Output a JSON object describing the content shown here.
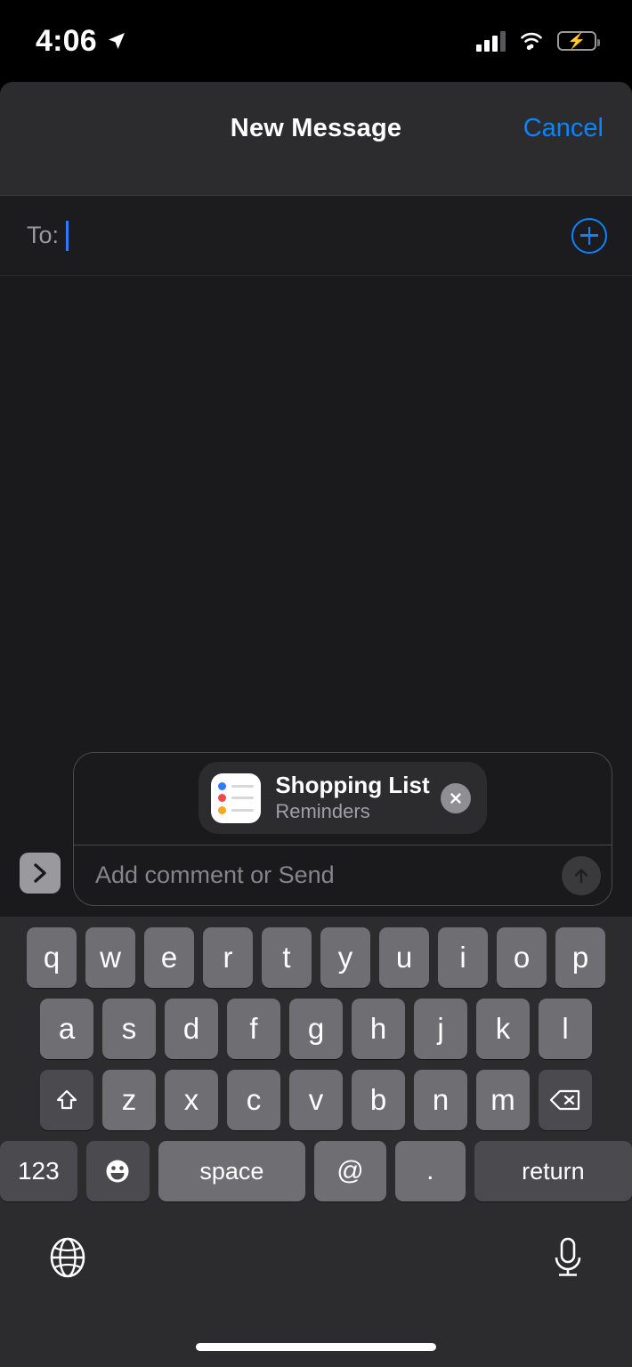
{
  "status_bar": {
    "time": "4:06",
    "location_icon": "location-arrow-icon",
    "signal_icon": "cellular-signal-icon",
    "wifi_icon": "wifi-icon",
    "battery_icon": "battery-charging-icon",
    "battery_color": "#4CD964"
  },
  "nav": {
    "title": "New Message",
    "cancel_label": "Cancel",
    "accent_color": "#0A84FF"
  },
  "recipient": {
    "to_label": "To:",
    "value": "",
    "add_contact_icon": "plus-circle-icon",
    "caret_color": "#3478F6"
  },
  "compose": {
    "expand_icon": "chevron-right-icon",
    "attachment": {
      "title": "Shopping List",
      "subtitle": "Reminders",
      "app_icon": "reminders-icon",
      "close_icon": "close-x-icon",
      "icon_dot_colors": [
        "#2F7CF6",
        "#F0484C",
        "#F5A623"
      ]
    },
    "comment_placeholder": "Add comment or Send",
    "send_icon": "arrow-up-icon"
  },
  "keyboard": {
    "row1": [
      "q",
      "w",
      "e",
      "r",
      "t",
      "y",
      "u",
      "i",
      "o",
      "p"
    ],
    "row2": [
      "a",
      "s",
      "d",
      "f",
      "g",
      "h",
      "j",
      "k",
      "l"
    ],
    "row3": [
      "z",
      "x",
      "c",
      "v",
      "b",
      "n",
      "m"
    ],
    "shift_icon": "shift-arrow-icon",
    "delete_icon": "backspace-icon",
    "numbers_label": "123",
    "emoji_icon": "emoji-smiley-icon",
    "space_label": "space",
    "at_label": "@",
    "period_label": ".",
    "return_label": "return",
    "globe_icon": "globe-icon",
    "mic_icon": "microphone-icon"
  }
}
